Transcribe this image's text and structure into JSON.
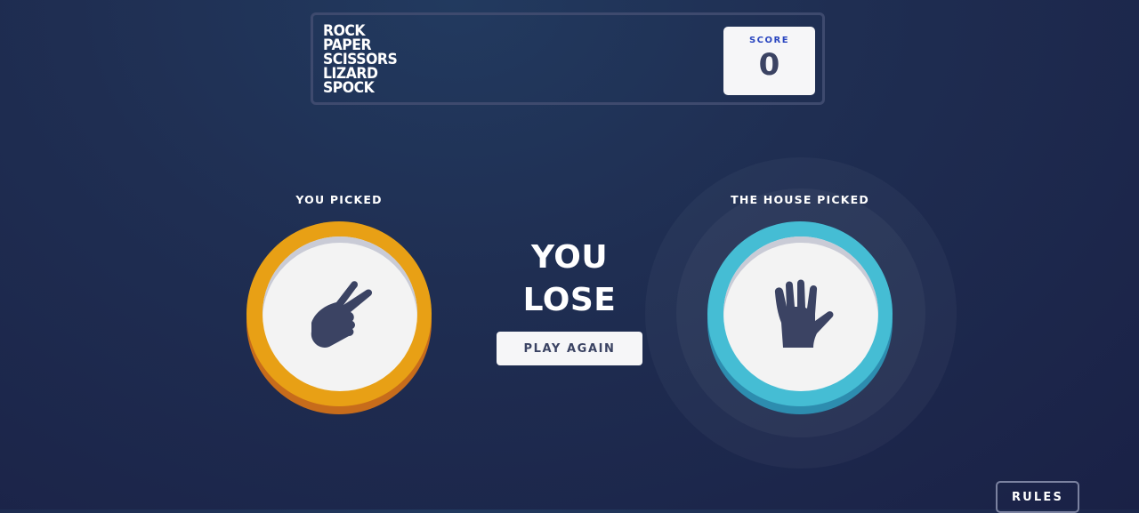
{
  "header": {
    "title_lines": [
      "ROCK",
      "PAPER",
      "SCISSORS",
      "LIZARD",
      "SPOCK"
    ],
    "score_label": "SCORE",
    "score_value": "0"
  },
  "player": {
    "label": "YOU PICKED",
    "choice": "scissors",
    "icon": "scissors-icon",
    "color": "#e8a015"
  },
  "house": {
    "label": "THE HOUSE PICKED",
    "choice": "spock",
    "icon": "spock-icon",
    "color": "#45bdd4"
  },
  "result": {
    "line1": "YOU",
    "line2": "LOSE"
  },
  "play_again_label": "PLAY AGAIN",
  "rules_label": "RULES"
}
